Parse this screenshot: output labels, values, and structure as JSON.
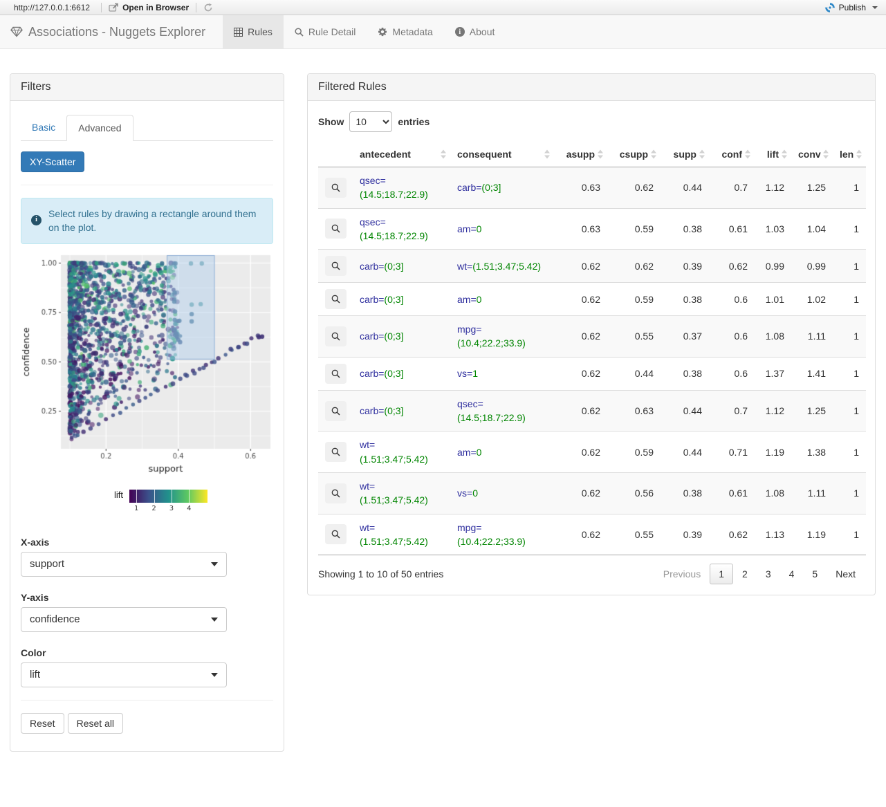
{
  "toolbar": {
    "url": "http://127.0.0.1:6612",
    "open_in_browser": "Open in Browser",
    "publish_label": "Publish"
  },
  "navbar": {
    "brand": "Associations - Nuggets Explorer",
    "tabs": [
      {
        "label": "Rules",
        "active": true
      },
      {
        "label": "Rule Detail",
        "active": false
      },
      {
        "label": "Metadata",
        "active": false
      },
      {
        "label": "About",
        "active": false
      }
    ]
  },
  "colors": {
    "primary": "#337ab7",
    "attr_name": "#2e2e9e",
    "attr_value": "#008500",
    "alert_bg": "#d9edf7",
    "alert_text": "#31708f",
    "publish_blue": "#2e88c8"
  },
  "filters": {
    "title": "Filters",
    "tabs": [
      {
        "label": "Basic",
        "active": false
      },
      {
        "label": "Advanced",
        "active": true
      }
    ],
    "scatter_button": "XY-Scatter",
    "info_text": "Select rules by drawing a rectangle around them on the plot.",
    "xaxis_label": "X-axis",
    "xaxis_value": "support",
    "yaxis_label": "Y-axis",
    "yaxis_value": "confidence",
    "color_label": "Color",
    "color_value": "lift",
    "reset_label": "Reset",
    "reset_all_label": "Reset all"
  },
  "chart_data": {
    "type": "scatter",
    "xlabel": "support",
    "ylabel": "confidence",
    "x_ticks": [
      0.2,
      0.4,
      0.6
    ],
    "y_ticks": [
      0.25,
      0.5,
      0.75,
      1.0
    ],
    "x_minor": [
      0.1,
      0.3,
      0.5
    ],
    "y_minor": [
      0.125,
      0.375,
      0.625,
      0.875
    ],
    "xlim": [
      0.075,
      0.655
    ],
    "ylim": [
      0.06,
      1.04
    ],
    "panel_bg": "#ebebeb",
    "grid_color": "#ffffff",
    "selection_rect": {
      "x0": 0.368,
      "x1": 0.501,
      "y0": 0.512,
      "y1": 1.04,
      "fill": "rgba(173,203,235,0.45)",
      "stroke": "rgba(135,170,210,0.9)"
    },
    "legend": {
      "label": "lift",
      "ticks": [
        1,
        2,
        3,
        4
      ],
      "domain": [
        0.6,
        5.05
      ],
      "colormap": "viridis",
      "stops": [
        "#440154",
        "#3b528b",
        "#21918c",
        "#5ec962",
        "#fde725"
      ]
    },
    "points_spec": {
      "seed": 7,
      "cloud_count": 1400,
      "extra": [
        [
          0.355,
          0.998,
          0.35,
          0.85
        ],
        [
          0.392,
          0.998,
          0.33,
          0.85
        ],
        [
          0.435,
          0.998,
          0.42,
          0.6
        ],
        [
          0.465,
          0.998,
          0.42,
          0.6
        ],
        [
          0.39,
          0.85,
          0.33,
          0.85
        ],
        [
          0.389,
          0.805,
          0.33,
          0.85
        ],
        [
          0.391,
          0.755,
          0.33,
          0.85
        ],
        [
          0.39,
          0.712,
          0.33,
          0.85
        ],
        [
          0.403,
          0.708,
          0.33,
          0.85
        ],
        [
          0.39,
          0.665,
          0.3,
          0.85
        ],
        [
          0.393,
          0.645,
          0.3,
          0.85
        ],
        [
          0.396,
          0.628,
          0.3,
          0.85
        ],
        [
          0.4,
          0.612,
          0.3,
          0.85
        ],
        [
          0.405,
          0.6,
          0.28,
          0.85
        ],
        [
          0.437,
          0.79,
          0.45,
          0.6
        ],
        [
          0.462,
          0.792,
          0.45,
          0.6
        ],
        [
          0.437,
          0.742,
          0.33,
          0.8
        ],
        [
          0.437,
          0.705,
          0.33,
          0.8
        ],
        [
          0.5,
          0.5,
          0.25,
          0.8
        ],
        [
          0.42,
          0.435,
          0.22,
          0.8
        ],
        [
          0.445,
          0.442,
          0.22,
          0.8
        ],
        [
          0.47,
          0.47,
          0.22,
          0.8
        ],
        [
          0.545,
          0.565,
          0.2,
          0.85
        ],
        [
          0.567,
          0.575,
          0.2,
          0.85
        ],
        [
          0.59,
          0.592,
          0.22,
          0.85
        ],
        [
          0.623,
          0.625,
          0.15,
          0.9
        ],
        [
          0.632,
          0.628,
          0.15,
          0.9
        ]
      ]
    }
  },
  "rules_panel": {
    "title": "Filtered Rules",
    "show_label": "Show",
    "entries_label": "entries",
    "page_length": "10",
    "columns": [
      "antecedent",
      "consequent",
      "asupp",
      "csupp",
      "supp",
      "conf",
      "lift",
      "conv",
      "len"
    ],
    "rows": [
      {
        "antecedent": {
          "name": "qsec=",
          "value": "(14.5;18.7;22.9)"
        },
        "consequent": {
          "name": "carb=",
          "value": "(0;3]"
        },
        "asupp": "0.63",
        "csupp": "0.62",
        "supp": "0.44",
        "conf": "0.7",
        "lift": "1.12",
        "conv": "1.25",
        "len": "1"
      },
      {
        "antecedent": {
          "name": "qsec=",
          "value": "(14.5;18.7;22.9)"
        },
        "consequent": {
          "name": "am=",
          "value": "0"
        },
        "asupp": "0.63",
        "csupp": "0.59",
        "supp": "0.38",
        "conf": "0.61",
        "lift": "1.03",
        "conv": "1.04",
        "len": "1"
      },
      {
        "antecedent": {
          "name": "carb=",
          "value": "(0;3]"
        },
        "consequent": {
          "name": "wt=",
          "value": "(1.51;3.47;5.42)"
        },
        "asupp": "0.62",
        "csupp": "0.62",
        "supp": "0.39",
        "conf": "0.62",
        "lift": "0.99",
        "conv": "0.99",
        "len": "1"
      },
      {
        "antecedent": {
          "name": "carb=",
          "value": "(0;3]"
        },
        "consequent": {
          "name": "am=",
          "value": "0"
        },
        "asupp": "0.62",
        "csupp": "0.59",
        "supp": "0.38",
        "conf": "0.6",
        "lift": "1.01",
        "conv": "1.02",
        "len": "1"
      },
      {
        "antecedent": {
          "name": "carb=",
          "value": "(0;3]"
        },
        "consequent": {
          "name": "mpg=",
          "value": "(10.4;22.2;33.9)"
        },
        "asupp": "0.62",
        "csupp": "0.55",
        "supp": "0.37",
        "conf": "0.6",
        "lift": "1.08",
        "conv": "1.11",
        "len": "1"
      },
      {
        "antecedent": {
          "name": "carb=",
          "value": "(0;3]"
        },
        "consequent": {
          "name": "vs=",
          "value": "1"
        },
        "asupp": "0.62",
        "csupp": "0.44",
        "supp": "0.38",
        "conf": "0.6",
        "lift": "1.37",
        "conv": "1.41",
        "len": "1"
      },
      {
        "antecedent": {
          "name": "carb=",
          "value": "(0;3]"
        },
        "consequent": {
          "name": "qsec=",
          "value": "(14.5;18.7;22.9)"
        },
        "asupp": "0.62",
        "csupp": "0.63",
        "supp": "0.44",
        "conf": "0.7",
        "lift": "1.12",
        "conv": "1.25",
        "len": "1"
      },
      {
        "antecedent": {
          "name": "wt=",
          "value": "(1.51;3.47;5.42)"
        },
        "consequent": {
          "name": "am=",
          "value": "0"
        },
        "asupp": "0.62",
        "csupp": "0.59",
        "supp": "0.44",
        "conf": "0.71",
        "lift": "1.19",
        "conv": "1.38",
        "len": "1"
      },
      {
        "antecedent": {
          "name": "wt=",
          "value": "(1.51;3.47;5.42)"
        },
        "consequent": {
          "name": "vs=",
          "value": "0"
        },
        "asupp": "0.62",
        "csupp": "0.56",
        "supp": "0.38",
        "conf": "0.61",
        "lift": "1.08",
        "conv": "1.11",
        "len": "1"
      },
      {
        "antecedent": {
          "name": "wt=",
          "value": "(1.51;3.47;5.42)"
        },
        "consequent": {
          "name": "mpg=",
          "value": "(10.4;22.2;33.9)"
        },
        "asupp": "0.62",
        "csupp": "0.55",
        "supp": "0.39",
        "conf": "0.62",
        "lift": "1.13",
        "conv": "1.19",
        "len": "1"
      }
    ],
    "footer": {
      "info": "Showing 1 to 10 of 50 entries",
      "previous": "Previous",
      "pages": [
        "1",
        "2",
        "3",
        "4",
        "5"
      ],
      "active_page": "1",
      "next": "Next"
    }
  }
}
